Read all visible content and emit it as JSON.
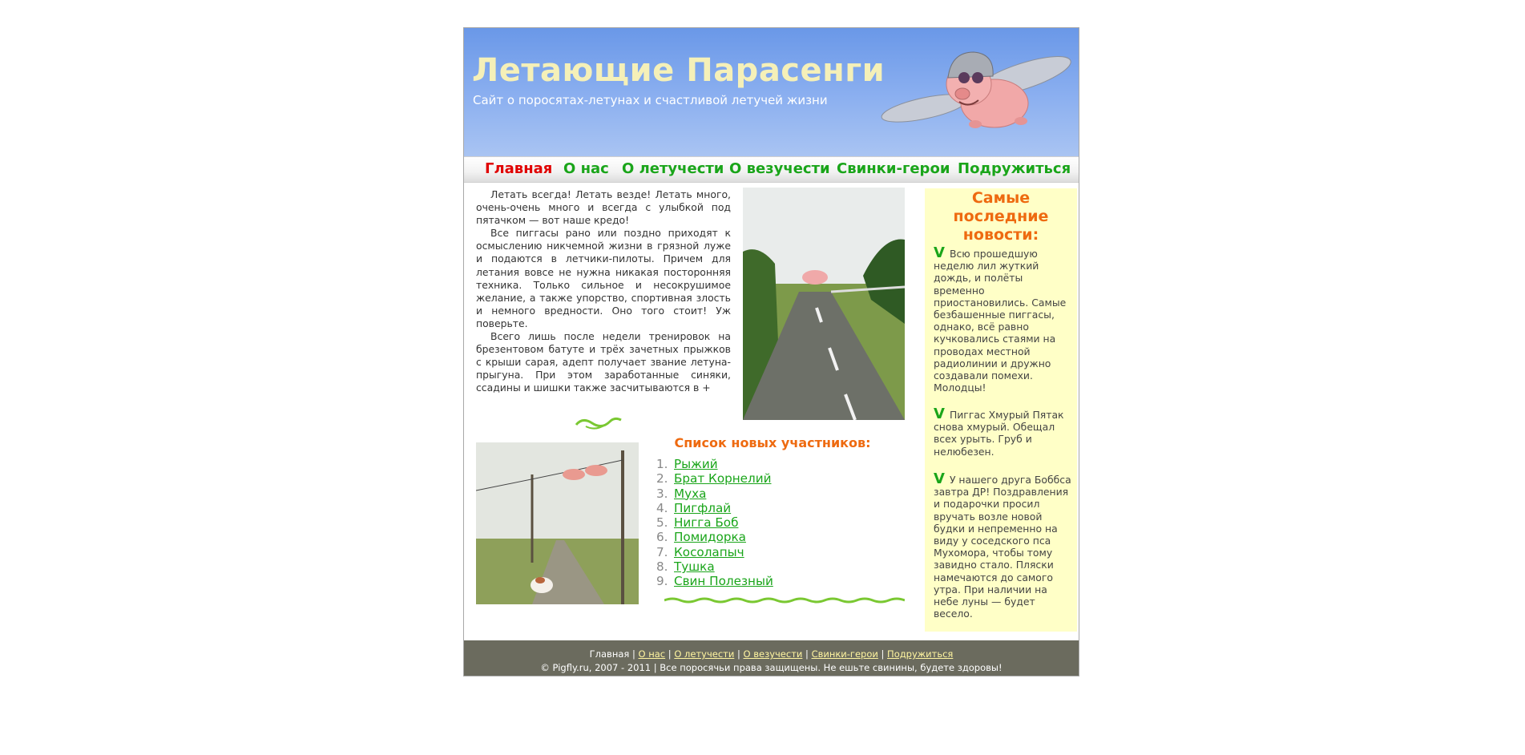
{
  "header": {
    "title": "Летающие Парасенги",
    "subtitle": "Сайт о поросятах-летунах и счастливой летучей жизни"
  },
  "nav": [
    {
      "label": "Главная",
      "active": true
    },
    {
      "label": "О нас"
    },
    {
      "label": "О летучести"
    },
    {
      "label": "О везучести"
    },
    {
      "label": "Свинки-герои"
    },
    {
      "label": "Подружиться"
    }
  ],
  "intro": [
    "Летать всегда! Летать везде! Летать много, очень-очень много и всегда с улыбкой под пятачком — вот наше кредо!",
    "Все пиггасы рано или поздно приходят к осмыслению никчемной жизни в грязной луже и подаются в летчики-пилоты. Причем для летания вовсе не нужна никакая посторонняя техника. Только сильное и несокрушимое желание, а также упорство, спортивная злость и немного вредности. Оно того стоит! Уж поверьте.",
    "Всего лишь после недели тренировок на брезентовом батуте и трёх зачетных прыжков с крыши сарая, адепт получает звание летуна-прыгуна. При этом заработанные синяки, ссадины и шишки также засчитываются в +"
  ],
  "members": {
    "title": "Список новых участников:",
    "items": [
      "Рыжий",
      "Брат Корнелий",
      "Муха",
      "Пигфлай",
      "Нигга Боб",
      "Помидорка",
      "Косолапыч",
      "Тушка",
      "Свин Полезный"
    ]
  },
  "news": {
    "title_lines": [
      "Самые",
      "последние",
      "новости:"
    ],
    "marker": "V",
    "items": [
      "Всю прошедшую неделю лил жуткий дождь, и полёты временно приостановились. Самые безбашенные пиггасы, однако, всё равно кучковались стаями на проводах местной радиолинии и дружно создавали помехи. Молодцы!",
      "Пиггас Хмурый Пятак снова хмурый. Обещал всех урыть. Груб и нелюбезен.",
      "У нашего друга Боббса завтра ДР! Поздравления и подарочки просил вручать возле новой будки и непременно на виду у соседского пса Мухомора, чтобы тому завидно стало. Пляски намечаются до самого утра. При наличии на небе луны — будет весело."
    ]
  },
  "footer": {
    "home": "Главная",
    "separator": "|",
    "links": [
      "О нас",
      "О летучести",
      "О везучести",
      "Свинки-герои",
      "Подружиться"
    ],
    "copyright": "© Pigfly.ru, 2007 - 2011 | Все поросячьи права защищены. Не ешьте свинины, будете здоровы!"
  },
  "colors": {
    "accent_green": "#1aa51a",
    "active_red": "#e00000",
    "heading_orange": "#ee6a10",
    "sidebar_bg": "#ffffc7",
    "footer_bg": "#6b6b5e"
  }
}
